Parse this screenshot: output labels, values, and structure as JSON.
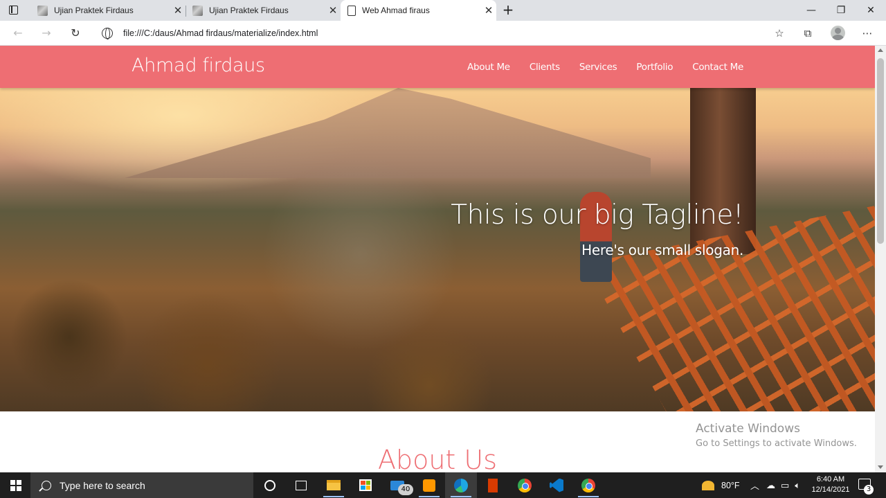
{
  "browser": {
    "tabs": [
      {
        "title": "Ujian Praktek Firdaus",
        "active": false
      },
      {
        "title": "Ujian Praktek Firdaus",
        "active": false
      },
      {
        "title": "Web Ahmad firaus",
        "active": true
      }
    ],
    "url": "file:///C:/daus/Ahmad firdaus/materialize/index.html"
  },
  "site": {
    "brand": "Ahmad firdaus",
    "nav_links": [
      "About Me",
      "Clients",
      "Services",
      "Portfolio",
      "Contact Me"
    ],
    "hero": {
      "tagline": "This is our big Tagline!",
      "slogan": "Here's our small slogan."
    },
    "about_title": "About Us",
    "accent_color": "#ee6e73"
  },
  "watermark": {
    "line1": "Activate Windows",
    "line2": "Go to Settings to activate Windows."
  },
  "taskbar": {
    "search_placeholder": "Type here to search",
    "mail_badge": "40",
    "weather": "80°F",
    "time": "6:40 AM",
    "date": "12/14/2021",
    "notification_count": "3"
  }
}
